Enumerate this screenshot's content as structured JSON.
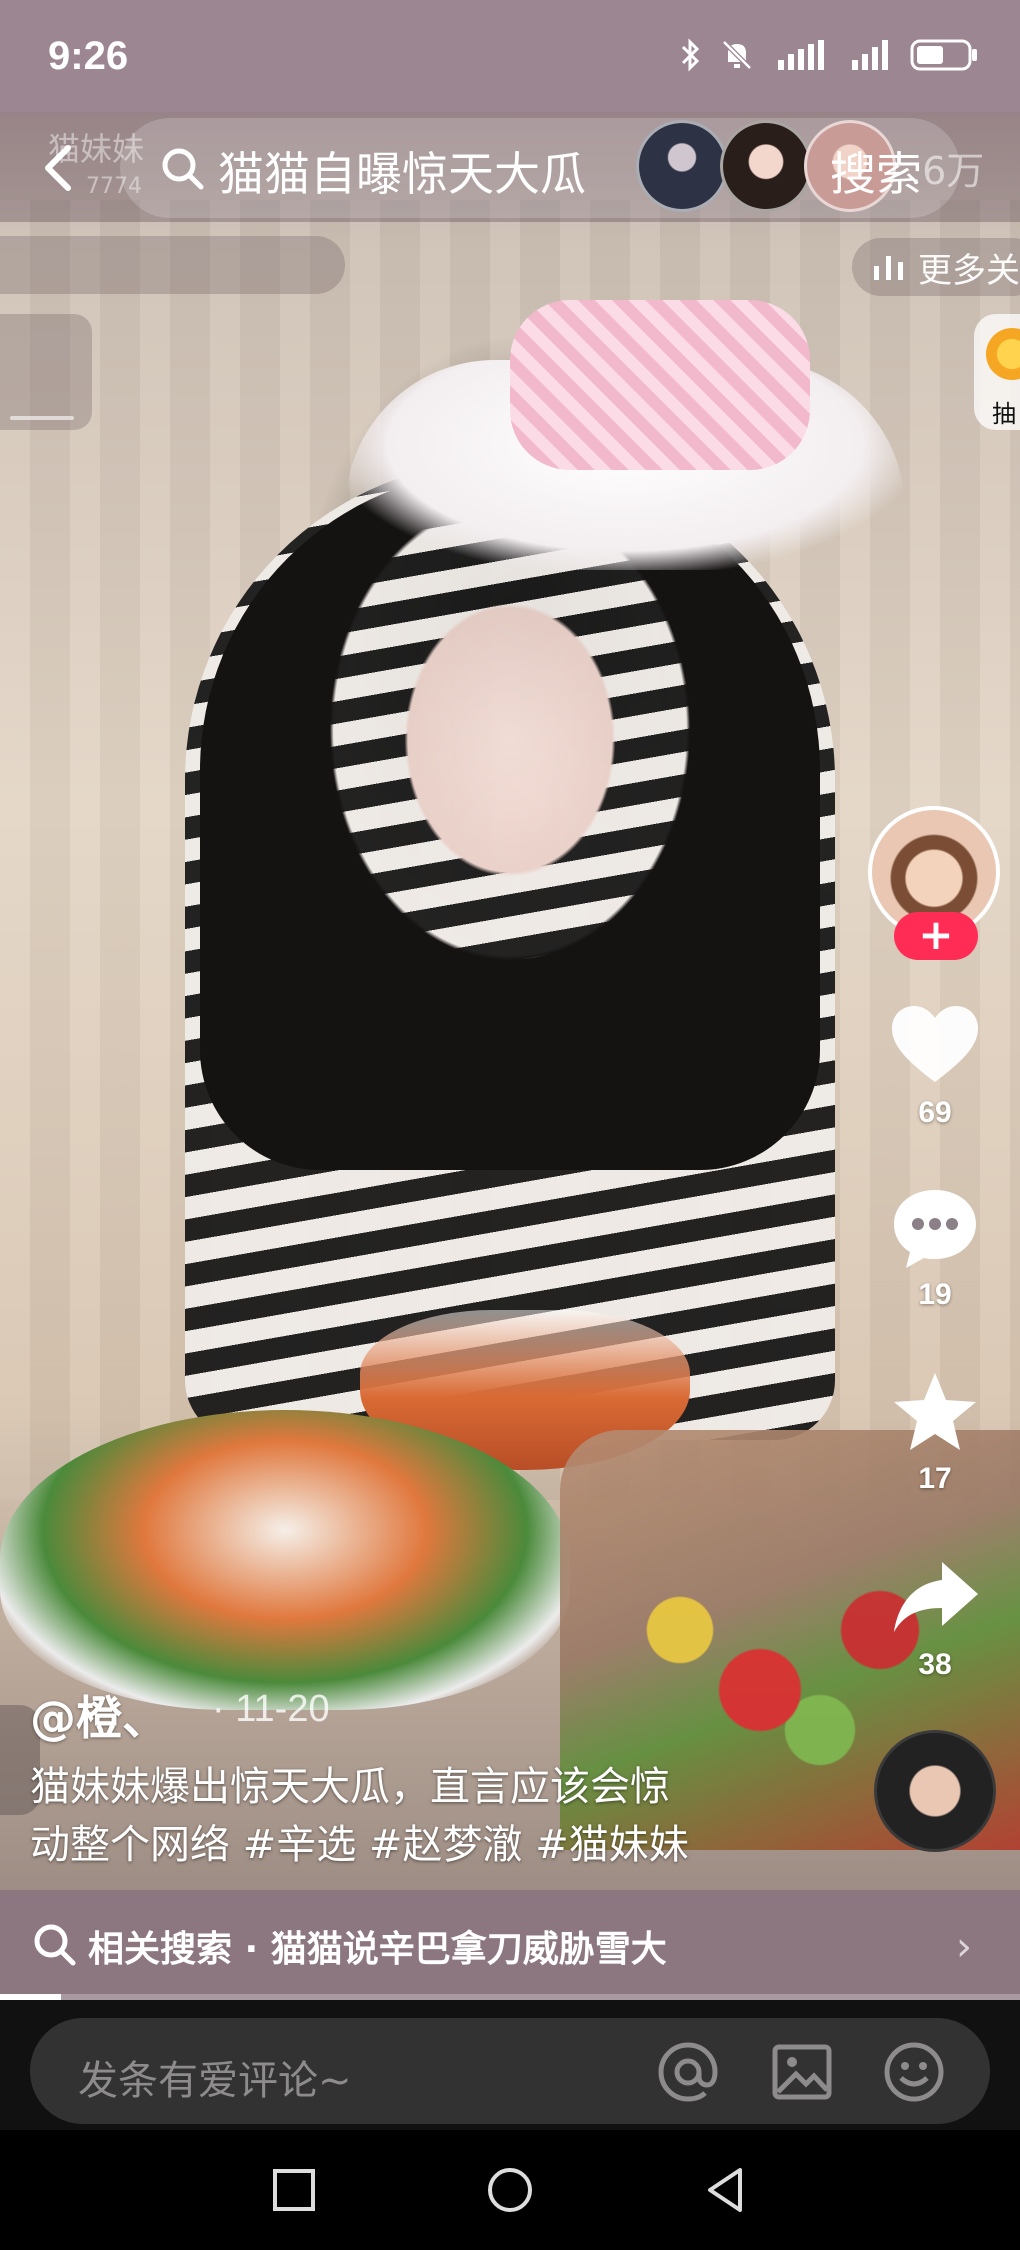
{
  "status_bar": {
    "time": "9:26",
    "icons": [
      "bluetooth-icon",
      "mute-icon",
      "signal-icon",
      "wifi-signal-icon",
      "battery-icon"
    ]
  },
  "top_bar": {
    "streamer_name": "猫妹妹",
    "streamer_count": "7774",
    "search_query": "猫猫自曝惊天大瓜",
    "search_button": "搜索",
    "view_count": ".6万"
  },
  "live_strip": {
    "more_live_label": "更多关",
    "lottery_label": "抽"
  },
  "actions": {
    "likes": "69",
    "comments": "19",
    "favorites": "17",
    "shares": "38",
    "follow_symbol": "+"
  },
  "caption": {
    "author": "@橙、",
    "date": "· 11-20",
    "line1": "猫妹妹爆出惊天大瓜，直言应该会惊",
    "line2": "动整个网络",
    "tags": [
      "#辛选",
      "#赵梦澈",
      "#猫妹妹"
    ],
    "hearts": "♥♥♥♥♥♥♥"
  },
  "related_search": {
    "label": "相关搜索 · 猫猫说辛巴拿刀威胁雪大",
    "arrow": "›"
  },
  "progress": {
    "fraction": 0.06
  },
  "comment_box": {
    "placeholder": "发条有爱评论~"
  },
  "colors": {
    "accent": "#ff2c55",
    "status_bar_bg": "#9c8691",
    "related_bar_bg": "#8c7780"
  }
}
